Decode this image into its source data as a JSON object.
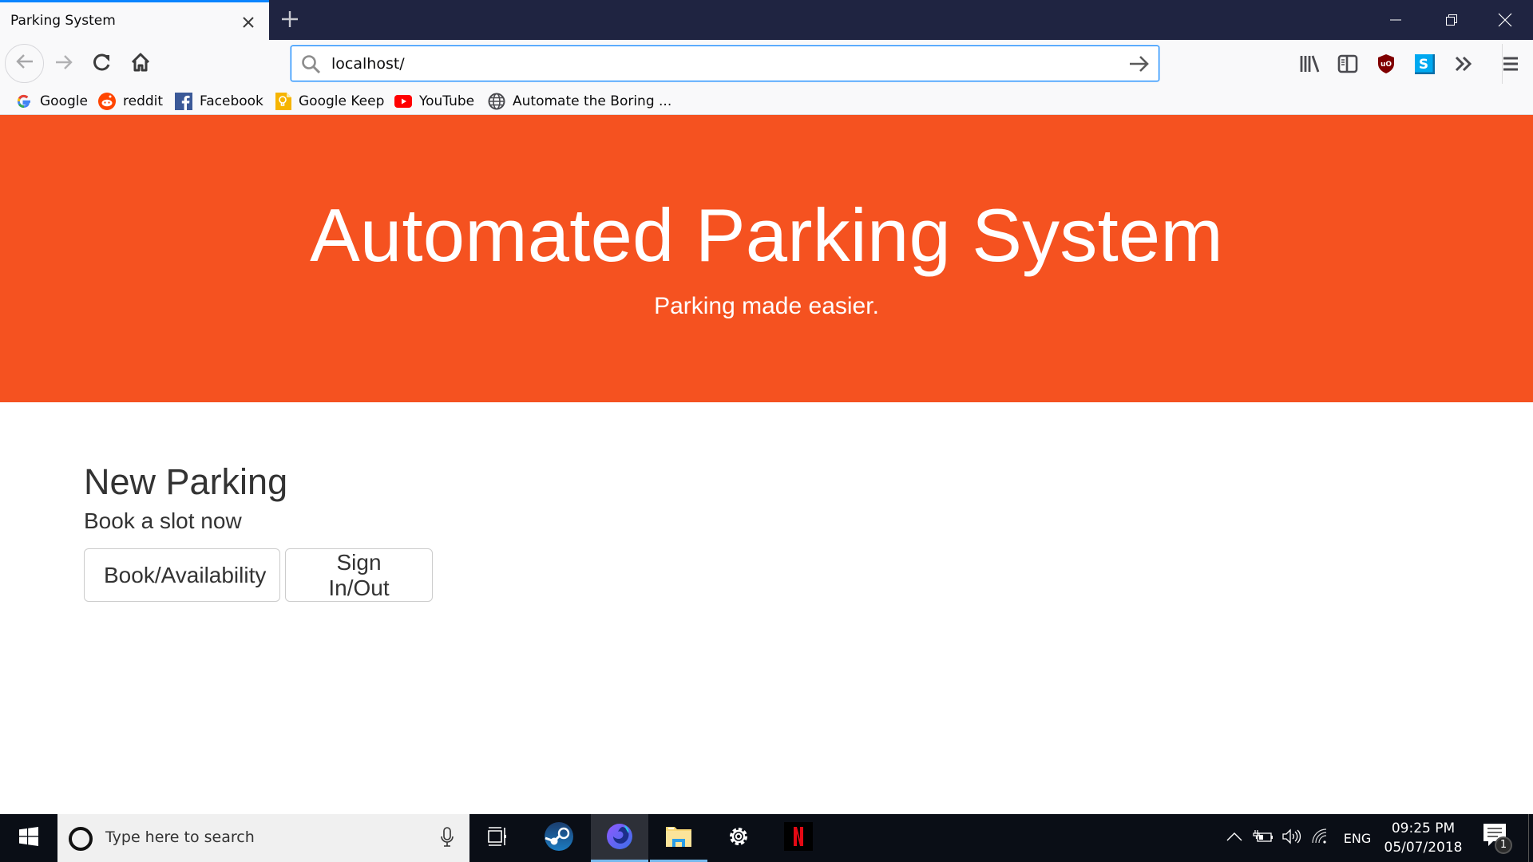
{
  "browser": {
    "tab": {
      "title": "Parking System",
      "close_icon": "close-icon"
    },
    "new_tab_icon": "plus-icon",
    "window_controls": {
      "minimize": "minimize-icon",
      "restore": "restore-icon",
      "close": "close-icon"
    },
    "nav": {
      "back": "arrow-left-icon",
      "forward": "arrow-right-icon",
      "reload": "reload-icon",
      "home": "home-icon"
    },
    "urlbar": {
      "value": "localhost/",
      "search_icon": "search-icon",
      "go_icon": "arrow-right-icon"
    },
    "toolbar_icons": [
      "library-icon",
      "sidebar-icon",
      "ublock-origin-icon",
      "skype-extension-icon",
      "overflow-chevrons-icon",
      "hamburger-menu-icon"
    ],
    "bookmarks": [
      {
        "label": "Google",
        "icon": "google-icon"
      },
      {
        "label": "reddit",
        "icon": "reddit-icon"
      },
      {
        "label": "Facebook",
        "icon": "facebook-icon"
      },
      {
        "label": "Google Keep",
        "icon": "google-keep-icon"
      },
      {
        "label": "YouTube",
        "icon": "youtube-icon"
      },
      {
        "label": "Automate the Boring ...",
        "icon": "globe-icon"
      }
    ]
  },
  "page": {
    "hero": {
      "title": "Automated Parking System",
      "subtitle": "Parking made easier.",
      "background_color": "#f55220"
    },
    "section": {
      "title": "New Parking",
      "subtitle": "Book a slot now",
      "buttons": [
        {
          "label": "Book/Availability"
        },
        {
          "label": "Sign In/Out"
        }
      ]
    }
  },
  "taskbar": {
    "search_placeholder": "Type here to search",
    "apps": [
      "task-view-icon",
      "steam-icon",
      "firefox-nightly-icon",
      "file-explorer-icon",
      "settings-icon",
      "netflix-icon"
    ],
    "tray": {
      "language": "ENG",
      "time": "09:25 PM",
      "date": "05/07/2018",
      "notification_count": "1"
    }
  }
}
